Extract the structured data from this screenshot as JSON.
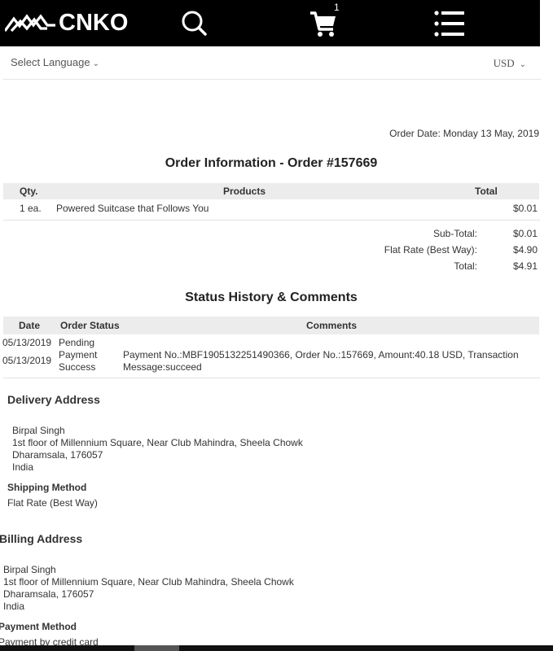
{
  "header": {
    "brand": "CNKO",
    "cart_count": "1",
    "icons": [
      "cnko-logo-icon",
      "search-icon",
      "cart-icon",
      "menu-icon"
    ]
  },
  "subbar": {
    "language_label": "Select Language",
    "currency": "USD"
  },
  "order": {
    "date_line": "Order Date: Monday 13 May, 2019",
    "title": "Order Information - Order #157669",
    "columns": {
      "qty": "Qty.",
      "products": "Products",
      "total": "Total"
    },
    "items": [
      {
        "qty": "1 ea.",
        "product": "Powered Suitcase that Follows You",
        "total": "$0.01"
      }
    ],
    "totals": [
      {
        "label": "Sub-Total:",
        "value": "$0.01"
      },
      {
        "label": "Flat Rate (Best Way):",
        "value": "$4.90"
      },
      {
        "label": "Total:",
        "value": "$4.91"
      }
    ]
  },
  "history": {
    "title": "Status History & Comments",
    "columns": {
      "date": "Date",
      "status": "Order Status",
      "comments": "Comments"
    },
    "rows": [
      {
        "date": "05/13/2019",
        "status_1": "Pending",
        "status_2": "",
        "comment_1": "",
        "comment_2": ""
      },
      {
        "date": "05/13/2019",
        "status_1": "Payment",
        "status_2": "Success",
        "comment_1": "Payment No.:MBF1905132251490366, Order No.:157669, Amount:40.18 USD, Transaction",
        "comment_2": "Message:succeed"
      }
    ]
  },
  "delivery": {
    "title": "Delivery Address",
    "lines": [
      "Birpal Singh",
      "1st floor of Millennium Square, Near Club Mahindra, Sheela Chowk",
      "Dharamsala, 176057",
      "India"
    ],
    "shipping_title": "Shipping Method",
    "shipping_value": "Flat Rate (Best Way)"
  },
  "billing": {
    "title": "Billing Address",
    "lines": [
      "Birpal Singh",
      "1st floor of Millennium Square, Near Club Mahindra, Sheela Chowk",
      "Dharamsala, 176057",
      "India"
    ],
    "payment_title": "Payment Method",
    "payment_value": "Payment by credit card"
  }
}
